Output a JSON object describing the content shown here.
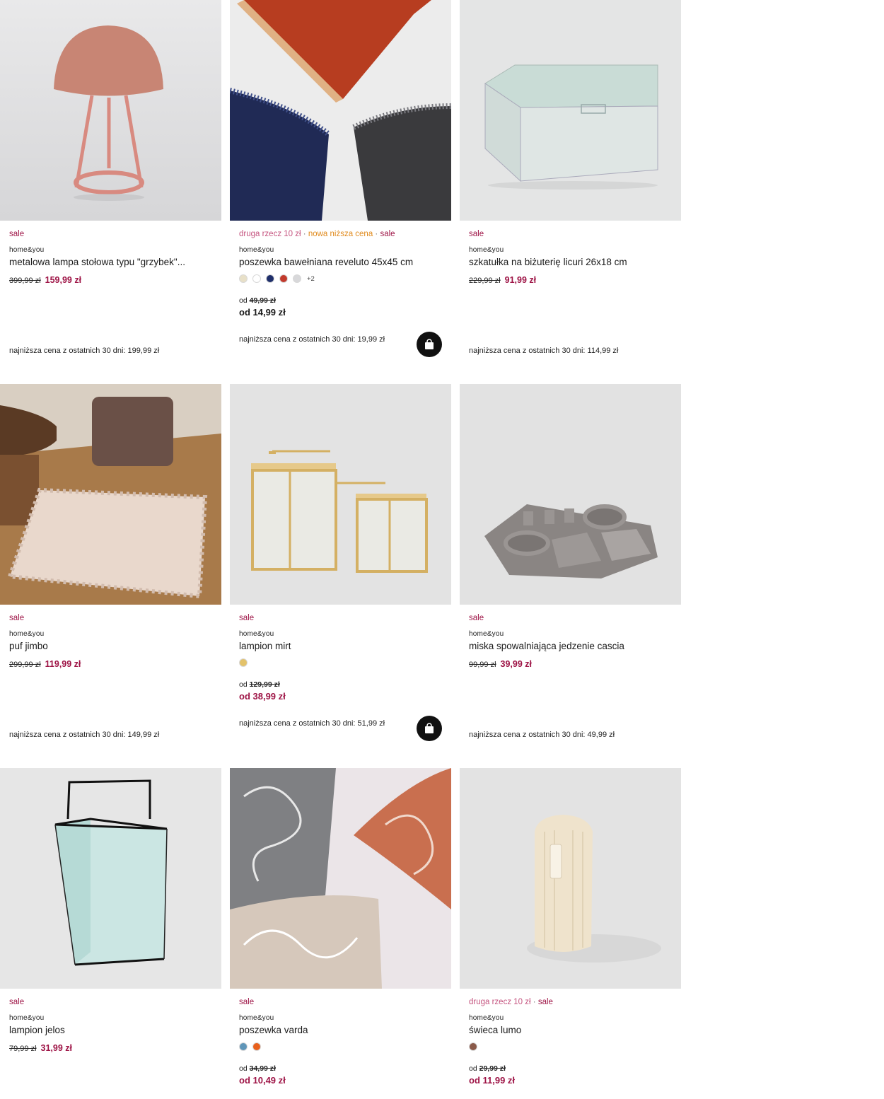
{
  "products": [
    {
      "badges": [
        "sale"
      ],
      "brand": "home&you",
      "title": "metalowa lampa stołowa typu \"grzybek\"...",
      "old_price": "399,99 zł",
      "new_price": "159,99 zł",
      "lowest": "najniższa cena z ostatnich 30 dni: 199,99 zł"
    },
    {
      "badges": [
        "druga rzecz 10 zł",
        "nowa niższa cena",
        "sale"
      ],
      "brand": "home&you",
      "title": "poszewka bawełniana reveluto 45x45 cm",
      "swatches": [
        "#e8e0c8",
        "#ffffff",
        "#1f2f6b",
        "#c23a2c",
        "#d8d8da"
      ],
      "more_colors": "+2",
      "od_prefix": "od",
      "old_price": "49,99 zł",
      "from_price": "od 14,99 zł",
      "lowest": "najniższa cena z ostatnich 30 dni: 19,99 zł"
    },
    {
      "badges": [
        "sale"
      ],
      "brand": "home&you",
      "title": "szkatułka na biżuterię licuri 26x18 cm",
      "old_price": "229,99 zł",
      "new_price": "91,99 zł",
      "lowest": "najniższa cena z ostatnich 30 dni: 114,99 zł"
    },
    {
      "badges": [
        "sale"
      ],
      "brand": "home&you",
      "title": "puf jimbo",
      "old_price": "299,99 zł",
      "new_price": "119,99 zł",
      "lowest": "najniższa cena z ostatnich 30 dni: 149,99 zł"
    },
    {
      "badges": [
        "sale"
      ],
      "brand": "home&you",
      "title": "lampion mirt",
      "swatches": [
        "#e3c26a"
      ],
      "od_prefix": "od",
      "old_price": "129,99 zł",
      "from_price": "od 38,99 zł",
      "lowest": "najniższa cena z ostatnich 30 dni: 51,99 zł"
    },
    {
      "badges": [
        "sale"
      ],
      "brand": "home&you",
      "title": "miska spowalniająca jedzenie cascia",
      "old_price": "99,99 zł",
      "new_price": "39,99 zł",
      "lowest": "najniższa cena z ostatnich 30 dni: 49,99 zł"
    },
    {
      "badges": [
        "sale"
      ],
      "brand": "home&you",
      "title": "lampion jelos",
      "old_price": "79,99 zł",
      "new_price": "31,99 zł"
    },
    {
      "badges": [
        "sale"
      ],
      "brand": "home&you",
      "title": "poszewka varda",
      "swatches": [
        "#5f95b8",
        "#e8601c"
      ],
      "od_prefix": "od",
      "old_price": "34,99 zł",
      "from_price": "od 10,49 zł"
    },
    {
      "badges": [
        "druga rzecz 10 zł",
        "sale"
      ],
      "brand": "home&you",
      "title": "świeca lumo",
      "swatches": [
        "#8a5a4a"
      ],
      "od_prefix": "od",
      "old_price": "29,99 zł",
      "from_price": "od 11,99 zł"
    }
  ],
  "icons": {
    "cart": "shopping-bag-icon"
  },
  "colors": {
    "sale": "#9e1446",
    "promo": "#c4527e",
    "new_lower": "#e08a1c"
  }
}
